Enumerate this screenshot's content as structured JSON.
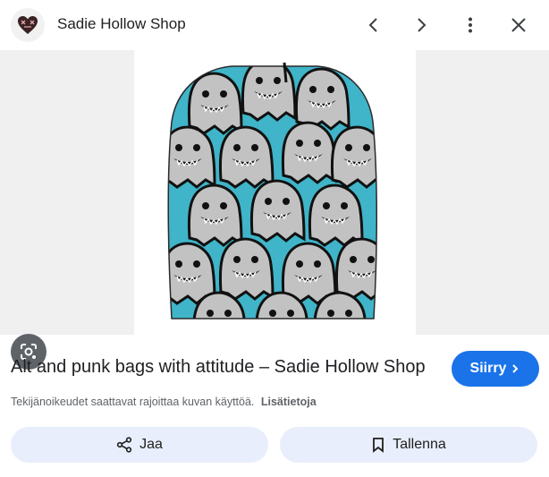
{
  "header": {
    "site_name": "Sadie Hollow Shop",
    "icons": [
      "heart-logo-icon",
      "chevron-left-icon",
      "chevron-right-icon",
      "more-vert-icon",
      "close-icon"
    ]
  },
  "image": {
    "subject": "backpack",
    "colors": {
      "background": "#40b4c8",
      "ghost": "#c2c2c2",
      "outline": "#111111"
    },
    "lens_icon": "google-lens-icon"
  },
  "result": {
    "title": "Alt and punk bags with attitude – Sadie Hollow Shop",
    "visit_label": "Siirry",
    "copyright_text": "Tekijänoikeudet saattavat rajoittaa kuvan käyttöä.",
    "learn_more": "Lisätietoja"
  },
  "actions": {
    "share_label": "Jaa",
    "save_label": "Tallenna"
  },
  "colors": {
    "accent": "#1a73e8",
    "action_bg": "#e8eefb"
  }
}
